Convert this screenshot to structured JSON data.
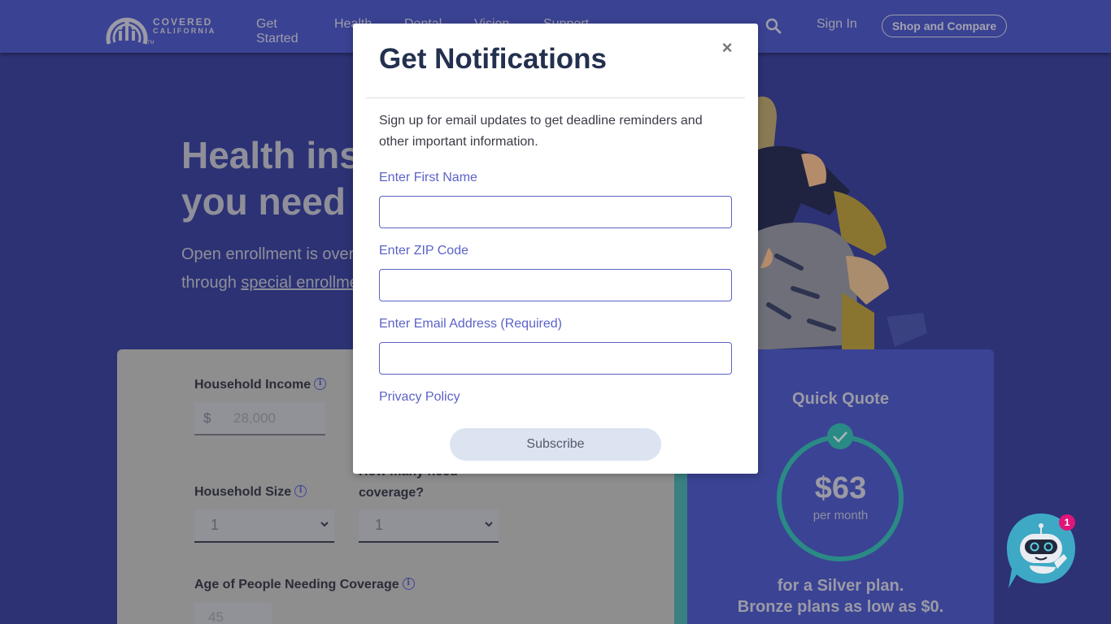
{
  "header": {
    "logo": {
      "line1": "COVERED",
      "line2": "CALIFORNIA",
      "tm": "TM"
    },
    "nav": [
      {
        "label": "Get Started"
      },
      {
        "label": "Health"
      },
      {
        "label": "Dental"
      },
      {
        "label": "Vision"
      },
      {
        "label": "Support"
      }
    ],
    "search_icon": "search-icon",
    "sign_in": "Sign In",
    "shop_compare": "Shop and Compare"
  },
  "hero": {
    "title_line1": "Health insurance",
    "title_line2": "you need it",
    "subtitle_line1": "Open enrollment is over",
    "subtitle_line2_prefix": "through ",
    "subtitle_link": "special enrollment"
  },
  "calculator": {
    "income_label": "Household Income",
    "income_currency": "$",
    "income_value": "28,000",
    "household_size_label": "Household Size",
    "household_size_value": "1",
    "coverage_label_line1": "How many need",
    "coverage_label_line2": "coverage?",
    "coverage_value": "1",
    "age_label": "Age of People Needing Coverage",
    "age_value": "45",
    "info_icon_glyph": "i"
  },
  "quote": {
    "title": "Quick Quote",
    "price": "$63",
    "per": "per month",
    "line1": "for a Silver plan.",
    "line2": "Bronze plans as low as $0."
  },
  "chatbot": {
    "badge_count": "1"
  },
  "modal": {
    "title": "Get Notifications",
    "close_glyph": "×",
    "description": "Sign up for email updates to get deadline reminders and other important information.",
    "fields": [
      {
        "label": "Enter First Name",
        "value": ""
      },
      {
        "label": "Enter ZIP Code",
        "value": ""
      },
      {
        "label": "Enter Email Address (Required)",
        "value": ""
      }
    ],
    "privacy_link": "Privacy Policy",
    "subscribe_label": "Subscribe"
  },
  "colors": {
    "header_bg": "#3a4293",
    "page_bg": "#2c3274",
    "modal_title": "#23304f",
    "accent_link": "#5b63c7",
    "subscribe_bg": "#dce3f1",
    "teal": "#2a8a85",
    "chat_badge": "#e0157a"
  }
}
